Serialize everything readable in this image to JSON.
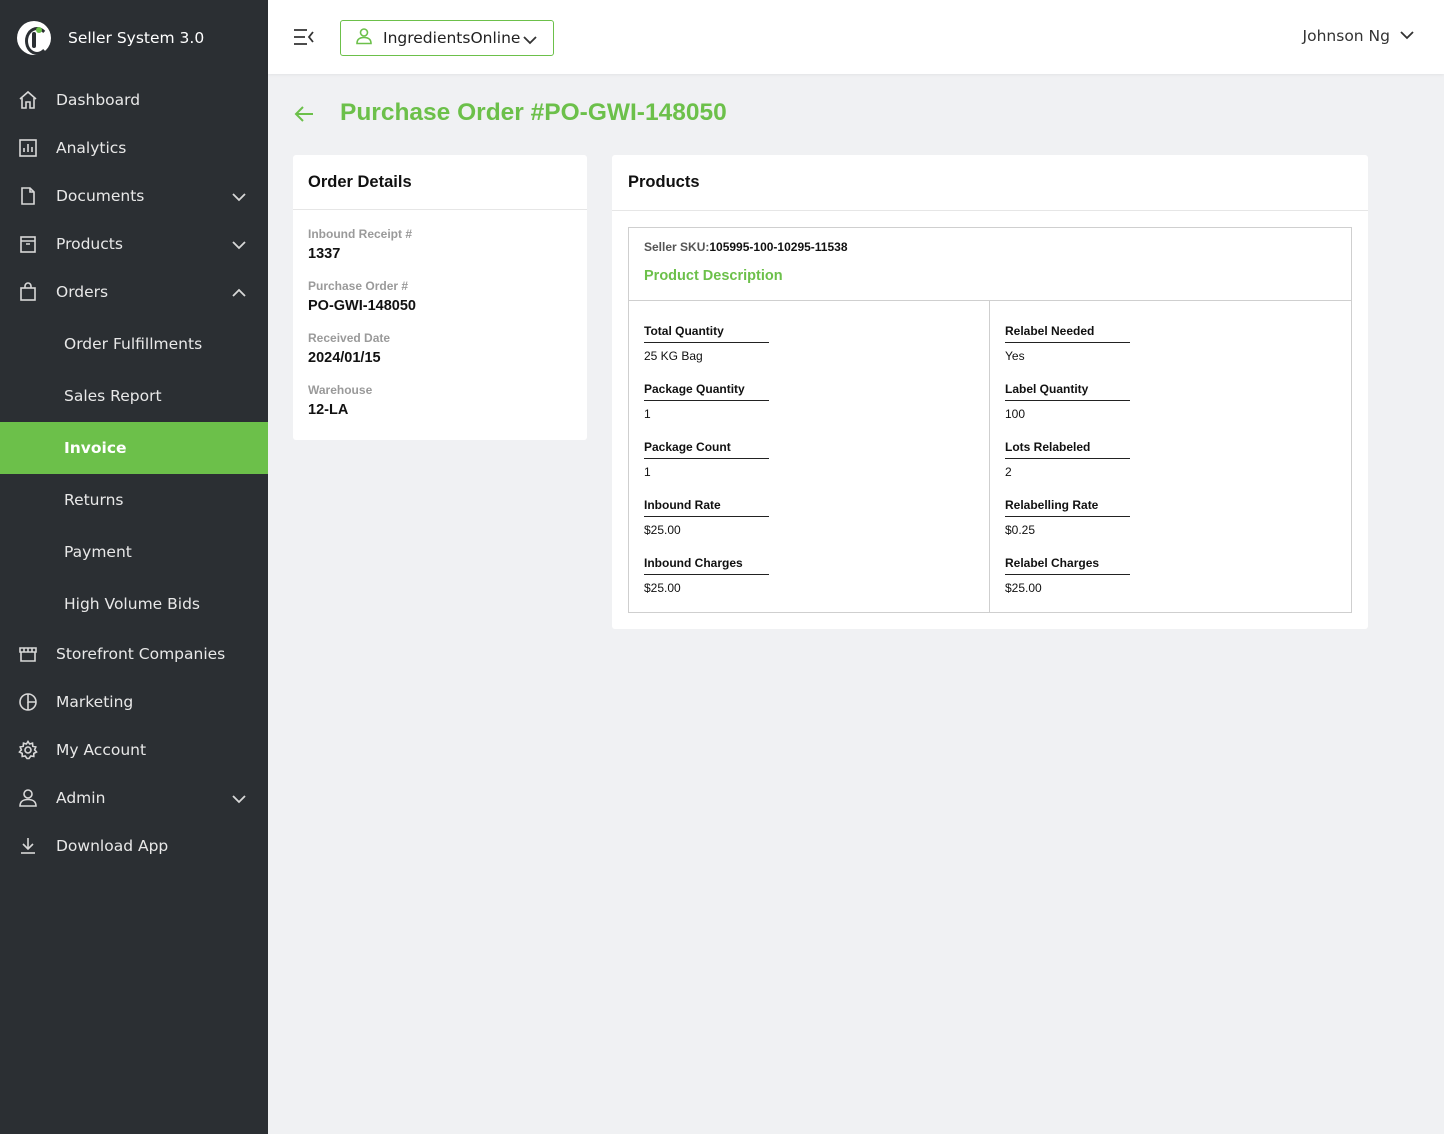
{
  "app": {
    "title": "Seller System 3.0"
  },
  "sidebar": {
    "items": [
      {
        "label": "Dashboard",
        "icon": "home-icon"
      },
      {
        "label": "Analytics",
        "icon": "analytics-icon"
      },
      {
        "label": "Documents",
        "icon": "document-icon",
        "expandable": true
      },
      {
        "label": "Products",
        "icon": "box-icon",
        "expandable": true
      },
      {
        "label": "Orders",
        "icon": "bag-icon",
        "expanded": true
      }
    ],
    "orders_sub": [
      {
        "label": "Order Fulfillments"
      },
      {
        "label": "Sales Report"
      },
      {
        "label": "Invoice",
        "active": true
      },
      {
        "label": "Returns"
      },
      {
        "label": "Payment"
      },
      {
        "label": "High Volume Bids"
      }
    ],
    "bottom_items": [
      {
        "label": "Storefront Companies",
        "icon": "storefront-icon"
      },
      {
        "label": "Marketing",
        "icon": "pie-chart-icon"
      },
      {
        "label": "My Account",
        "icon": "gear-icon"
      },
      {
        "label": "Admin",
        "icon": "user-icon",
        "expandable": true
      },
      {
        "label": "Download App",
        "icon": "download-icon"
      }
    ]
  },
  "topbar": {
    "store": "IngredientsOnline",
    "user": "Johnson Ng"
  },
  "page": {
    "title": "Purchase Order #PO-GWI-148050"
  },
  "order_details": {
    "title": "Order Details",
    "fields": [
      {
        "label": "Inbound Receipt #",
        "value": "1337"
      },
      {
        "label": "Purchase Order #",
        "value": "PO-GWI-148050"
      },
      {
        "label": "Received Date",
        "value": "2024/01/15"
      },
      {
        "label": "Warehouse",
        "value": "12-LA"
      }
    ]
  },
  "products": {
    "title": "Products",
    "sku_label": "Seller SKU:",
    "sku_value": "105995-100-10295-11538",
    "description": "Product Description",
    "left_fields": [
      {
        "label": "Total Quantity",
        "value": "25 KG Bag"
      },
      {
        "label": "Package Quantity",
        "value": "1"
      },
      {
        "label": "Package Count",
        "value": "1"
      },
      {
        "label": "Inbound Rate",
        "value": "$25.00"
      },
      {
        "label": "Inbound Charges",
        "value": "$25.00"
      }
    ],
    "right_fields": [
      {
        "label": "Relabel Needed",
        "value": "Yes"
      },
      {
        "label": "Label Quantity",
        "value": "100"
      },
      {
        "label": "Lots Relabeled",
        "value": "2"
      },
      {
        "label": "Relabelling Rate",
        "value": "$0.25"
      },
      {
        "label": "Relabel Charges",
        "value": "$25.00"
      }
    ]
  },
  "colors": {
    "accent": "#6cc04a",
    "sidebar": "#2b2f33",
    "background": "#f0f1f3"
  }
}
